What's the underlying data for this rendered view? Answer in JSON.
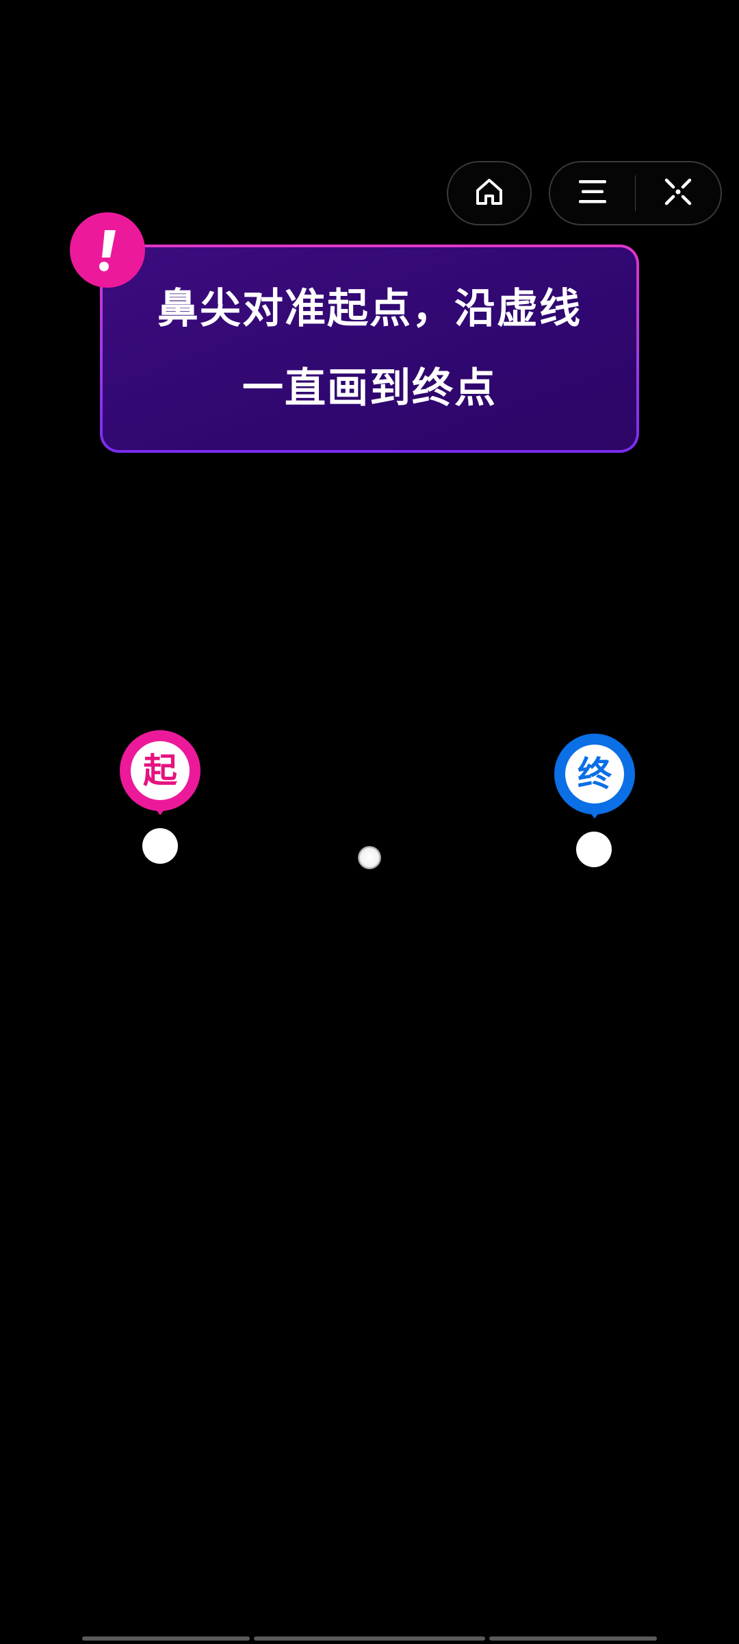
{
  "toolbar": {
    "home_icon": "home-icon",
    "menu_icon": "menu-icon",
    "close_icon": "close-icon"
  },
  "tip": {
    "badge_symbol": "!",
    "line1": "鼻尖对准起点，沿虚线",
    "line2": "一直画到终点"
  },
  "markers": {
    "start_label": "起",
    "end_label": "终"
  },
  "colors": {
    "background": "#000000",
    "tip_fill": "#34086f",
    "tip_border": "#b23ad9",
    "accent_pink": "#ec1a9b",
    "accent_blue": "#0b6fe6"
  },
  "progress": {
    "segments": 3
  }
}
